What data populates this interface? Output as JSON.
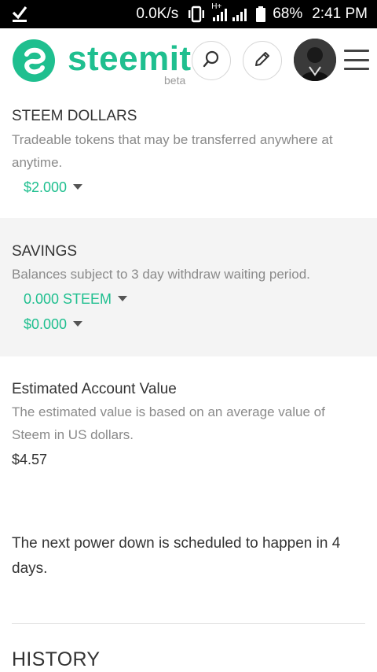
{
  "status_bar": {
    "net_speed": "0.0K/s",
    "network_type": "H+",
    "battery_pct": "68%",
    "time": "2:41 PM",
    "icons": [
      "check-download-icon",
      "vibrate-icon",
      "signal-icon",
      "battery-icon"
    ]
  },
  "header": {
    "brand": "steemit",
    "beta": "beta",
    "icons": [
      "search-icon",
      "pencil-icon",
      "avatar",
      "hamburger-menu-icon"
    ]
  },
  "steem_dollars": {
    "title": "STEEM DOLLARS",
    "description": "Tradeable tokens that may be transferred anywhere at anytime.",
    "amount": "$2.000"
  },
  "savings": {
    "title": "SAVINGS",
    "description": "Balances subject to 3 day withdraw waiting period.",
    "steem_amount": "0.000 STEEM",
    "dollar_amount": "$0.000"
  },
  "estimated": {
    "title": "Estimated Account Value",
    "description": "The estimated value is based on an average value of Steem in US dollars.",
    "value": "$4.57"
  },
  "power_down": {
    "text": "The next power down is scheduled to happen  in 4 days."
  },
  "history": {
    "title": "HISTORY"
  },
  "colors": {
    "accent": "#1fbf8f",
    "muted_text": "#8a8a8a",
    "savings_bg": "#f4f4f4"
  }
}
